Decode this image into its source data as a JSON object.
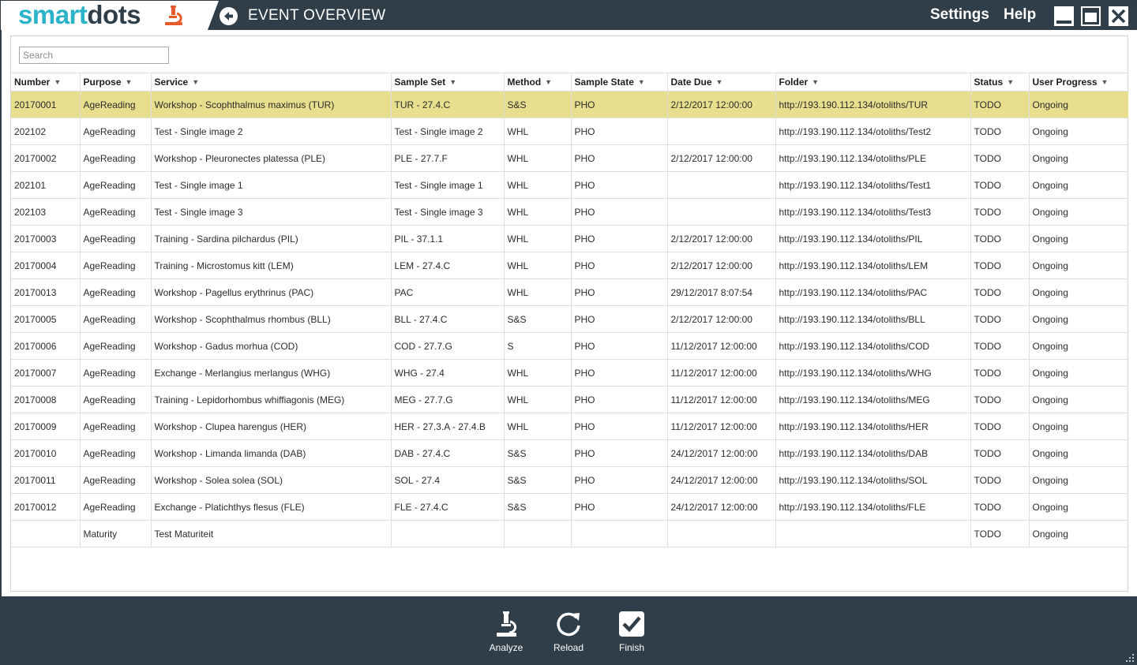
{
  "app": {
    "logo_smart": "smart",
    "logo_dots": "dots",
    "page_title": "EVENT OVERVIEW",
    "settings_label": "Settings",
    "help_label": "Help"
  },
  "search": {
    "placeholder": "Search",
    "value": ""
  },
  "columns": [
    "Number",
    "Purpose",
    "Service",
    "Sample Set",
    "Method",
    "Sample State",
    "Date Due",
    "Folder",
    "Status",
    "User Progress"
  ],
  "rows": [
    [
      "20170001",
      "AgeReading",
      "Workshop - Scophthalmus maximus (TUR)",
      "TUR - 27.4.C",
      "S&S",
      "PHO",
      "2/12/2017 12:00:00",
      "http://193.190.112.134/otoliths/TUR",
      "TODO",
      "Ongoing"
    ],
    [
      "202102",
      "AgeReading",
      "Test - Single image 2",
      "Test - Single image 2",
      "WHL",
      "PHO",
      "",
      "http://193.190.112.134/otoliths/Test2",
      "TODO",
      "Ongoing"
    ],
    [
      "20170002",
      "AgeReading",
      "Workshop - Pleuronectes platessa (PLE)",
      "PLE - 27.7.F",
      "WHL",
      "PHO",
      "2/12/2017 12:00:00",
      "http://193.190.112.134/otoliths/PLE",
      "TODO",
      "Ongoing"
    ],
    [
      "202101",
      "AgeReading",
      "Test - Single image 1",
      "Test - Single image 1",
      "WHL",
      "PHO",
      "",
      "http://193.190.112.134/otoliths/Test1",
      "TODO",
      "Ongoing"
    ],
    [
      "202103",
      "AgeReading",
      "Test - Single image 3",
      "Test - Single image 3",
      "WHL",
      "PHO",
      "",
      "http://193.190.112.134/otoliths/Test3",
      "TODO",
      "Ongoing"
    ],
    [
      "20170003",
      "AgeReading",
      "Training - Sardina pilchardus (PIL)",
      "PIL - 37.1.1",
      "WHL",
      "PHO",
      "2/12/2017 12:00:00",
      "http://193.190.112.134/otoliths/PIL",
      "TODO",
      "Ongoing"
    ],
    [
      "20170004",
      "AgeReading",
      "Training - Microstomus kitt (LEM)",
      "LEM - 27.4.C",
      "WHL",
      "PHO",
      "2/12/2017 12:00:00",
      "http://193.190.112.134/otoliths/LEM",
      "TODO",
      "Ongoing"
    ],
    [
      "20170013",
      "AgeReading",
      "Workshop - Pagellus erythrinus (PAC)",
      "PAC",
      "WHL",
      "PHO",
      "29/12/2017 8:07:54",
      "http://193.190.112.134/otoliths/PAC",
      "TODO",
      "Ongoing"
    ],
    [
      "20170005",
      "AgeReading",
      "Workshop - Scophthalmus rhombus (BLL)",
      "BLL - 27.4.C",
      "S&S",
      "PHO",
      "2/12/2017 12:00:00",
      "http://193.190.112.134/otoliths/BLL",
      "TODO",
      "Ongoing"
    ],
    [
      "20170006",
      "AgeReading",
      "Workshop - Gadus morhua (COD)",
      "COD - 27.7.G",
      "S",
      "PHO",
      "11/12/2017 12:00:00",
      "http://193.190.112.134/otoliths/COD",
      "TODO",
      "Ongoing"
    ],
    [
      "20170007",
      "AgeReading",
      "Exchange - Merlangius merlangus (WHG)",
      "WHG - 27.4",
      "WHL",
      "PHO",
      "11/12/2017 12:00:00",
      "http://193.190.112.134/otoliths/WHG",
      "TODO",
      "Ongoing"
    ],
    [
      "20170008",
      "AgeReading",
      "Training - Lepidorhombus whiffiagonis (MEG)",
      "MEG - 27.7.G",
      "WHL",
      "PHO",
      "11/12/2017 12:00:00",
      "http://193.190.112.134/otoliths/MEG",
      "TODO",
      "Ongoing"
    ],
    [
      "20170009",
      "AgeReading",
      "Workshop - Clupea harengus (HER)",
      "HER - 27.3.A - 27.4.B",
      "WHL",
      "PHO",
      "11/12/2017 12:00:00",
      "http://193.190.112.134/otoliths/HER",
      "TODO",
      "Ongoing"
    ],
    [
      "20170010",
      "AgeReading",
      "Workshop - Limanda limanda (DAB)",
      "DAB - 27.4.C",
      "S&S",
      "PHO",
      "24/12/2017 12:00:00",
      "http://193.190.112.134/otoliths/DAB",
      "TODO",
      "Ongoing"
    ],
    [
      "20170011",
      "AgeReading",
      "Workshop - Solea solea (SOL)",
      "SOL - 27.4",
      "S&S",
      "PHO",
      "24/12/2017 12:00:00",
      "http://193.190.112.134/otoliths/SOL",
      "TODO",
      "Ongoing"
    ],
    [
      "20170012",
      "AgeReading",
      "Exchange - Platichthys flesus (FLE)",
      "FLE - 27.4.C",
      "S&S",
      "PHO",
      "24/12/2017 12:00:00",
      "http://193.190.112.134/otoliths/FLE",
      "TODO",
      "Ongoing"
    ],
    [
      "",
      "Maturity",
      "Test Maturiteit",
      "",
      "",
      "",
      "",
      "",
      "TODO",
      "Ongoing"
    ]
  ],
  "selected_row": 0,
  "actions": {
    "analyze_label": "Analyze",
    "reload_label": "Reload",
    "finish_label": "Finish"
  },
  "icons": {
    "back": "back-arrow-icon",
    "filter": "filter-icon",
    "minimize": "minimize-icon",
    "maximize": "maximize-icon",
    "close": "close-icon",
    "analyze": "microscope-icon",
    "reload": "reload-icon",
    "finish": "checkbox-icon"
  },
  "colors": {
    "chrome": "#2f3e48",
    "accent": "#2ab3c8",
    "logo_orange": "#e85a2a",
    "selected_row": "#e7df8e"
  }
}
